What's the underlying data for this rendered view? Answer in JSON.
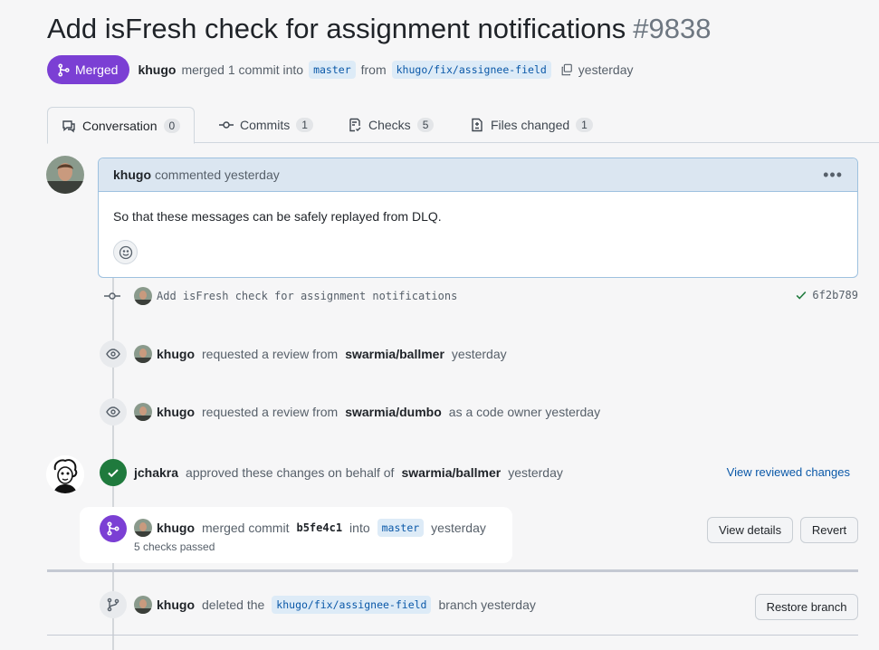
{
  "pr": {
    "title": "Add isFresh check for assignment notifications",
    "number": "#9838",
    "status": "Merged",
    "author": "khugo",
    "merge_text": "merged 1 commit into",
    "base_branch": "master",
    "from_text": "from",
    "head_branch": "khugo/fix/assignee-field",
    "time": "yesterday"
  },
  "tabs": [
    {
      "label": "Conversation",
      "count": "0"
    },
    {
      "label": "Commits",
      "count": "1"
    },
    {
      "label": "Checks",
      "count": "5"
    },
    {
      "label": "Files changed",
      "count": "1"
    }
  ],
  "comment": {
    "author": "khugo",
    "action": "commented yesterday",
    "body": "So that these messages can be safely replayed from DLQ."
  },
  "commit": {
    "message": "Add isFresh check for assignment notifications",
    "sha": "6f2b789"
  },
  "events": {
    "review1": {
      "user": "khugo",
      "text": "requested a review from",
      "team": "swarmia/ballmer",
      "time": "yesterday"
    },
    "review2": {
      "user": "khugo",
      "text": "requested a review from",
      "team": "swarmia/dumbo",
      "suffix": "as a code owner yesterday"
    },
    "approve": {
      "user": "jchakra",
      "text": "approved these changes on behalf of",
      "team": "swarmia/ballmer",
      "time": "yesterday",
      "link": "View reviewed changes"
    },
    "merge": {
      "user": "khugo",
      "text": "merged commit",
      "sha": "b5fe4c1",
      "into": "into",
      "branch": "master",
      "time": "yesterday",
      "checks": "5 checks passed",
      "details_btn": "View details",
      "revert_btn": "Revert"
    },
    "deleted": {
      "user": "khugo",
      "text": "deleted the",
      "branch": "khugo/fix/assignee-field",
      "suffix": "branch yesterday",
      "restore_btn": "Restore branch"
    }
  },
  "colors": {
    "merged": "#7b3fd4",
    "approved": "#1f7a3d",
    "link": "#0a58a8"
  }
}
